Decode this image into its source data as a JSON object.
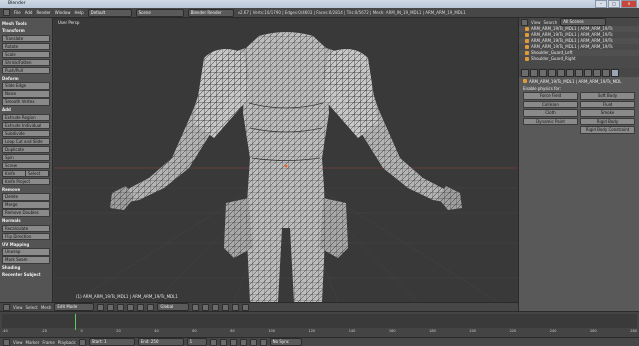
{
  "window": {
    "title": "Blender",
    "minimize": "–",
    "maximize": "□",
    "close": "✕"
  },
  "menubar": {
    "items": [
      "File",
      "Add",
      "Render",
      "Window",
      "Help"
    ],
    "screen": "Default",
    "scene": "Scene",
    "engine": "Blender Render",
    "stats": "v2.67 | Verts:10/1790 | Edges:0/4603 | Faces:0/2814 | Tris:0/5672 | Mesh: ARM_IN_19_MDL1 | ARM_ARM_19_MDL1"
  },
  "toolshelf": {
    "header": "Mesh Tools",
    "sections": [
      {
        "title": "Transform",
        "buttons": [
          "Translate",
          "Rotate",
          "Scale",
          "Shrink/Fatten",
          "Push/Pull"
        ]
      },
      {
        "title": "Deform",
        "buttons": [
          "Slide Edge",
          "Noise",
          "Smooth Vertex"
        ]
      },
      {
        "title": "Add",
        "buttons": [
          "Extrude Region",
          "Extrude Individual",
          "Subdivide",
          "Loop Cut and Slide",
          "Duplicate",
          "Spin",
          "Screw"
        ]
      },
      {
        "title": "",
        "pairs": [
          [
            "Knife",
            "Select"
          ]
        ],
        "buttons": [
          "Knife Project"
        ]
      },
      {
        "title": "Remove",
        "buttons": [
          "Delete",
          "Merge",
          "Remove Doubles"
        ]
      },
      {
        "title": "Normals",
        "buttons": [
          "Recalculate",
          "Flip Direction"
        ]
      },
      {
        "title": "UV Mapping",
        "buttons": [
          "Unwrap",
          "Mark Seam"
        ]
      },
      {
        "title": "Shading",
        "buttons": []
      }
    ],
    "footer": "Recenter Subject"
  },
  "viewport": {
    "label": "User Persp",
    "info": "(1) ARM_ARM_19/Ts_MDL1 | ARM_ARM_19/Ts_MDL1"
  },
  "viewheader": {
    "items": [
      "View",
      "Select",
      "Mesh"
    ],
    "mode": "Edit Mode",
    "pivot": "Global"
  },
  "outliner": {
    "view": "View",
    "search": "Search",
    "filter": "All Scenes",
    "rows": [
      "ARM_ARM_19/Ts_MDL1 | ARM_ARM_19/Ts",
      "ARM_ARM_19/Ts_MDL1 | ARM_ARM_19/Ts",
      "ARM_ARM_19/Ts_MDL1 | ARM_ARM_19/Ts",
      "ARM_ARM_19/Ts_MDL1 | ARM_ARM_19/Ts",
      "Shoulder_Guard_Left",
      "Shoulder_Guard_Right"
    ]
  },
  "properties": {
    "context": "ARM_ARM_19/Ts_MDL1 | ARM_ARM_19/Ts_MDL",
    "section": "Enable physics for:",
    "buttons": [
      "Force Field",
      "Soft Body",
      "Collision",
      "Fluid",
      "Cloth",
      "Smoke",
      "Dynamic Paint",
      "Rigid Body",
      "",
      "Rigid Body Constraint"
    ]
  },
  "timeline": {
    "ticks": [
      "-40",
      "-20",
      "0",
      "20",
      "40",
      "60",
      "80",
      "100",
      "120",
      "140",
      "160",
      "180",
      "200",
      "220",
      "240",
      "260",
      "280"
    ]
  },
  "tlheader": {
    "items": [
      "View",
      "Marker",
      "Frame",
      "Playback"
    ],
    "start": "Start: 1",
    "end": "End: 250",
    "current": "1",
    "sync": "No Sync"
  }
}
